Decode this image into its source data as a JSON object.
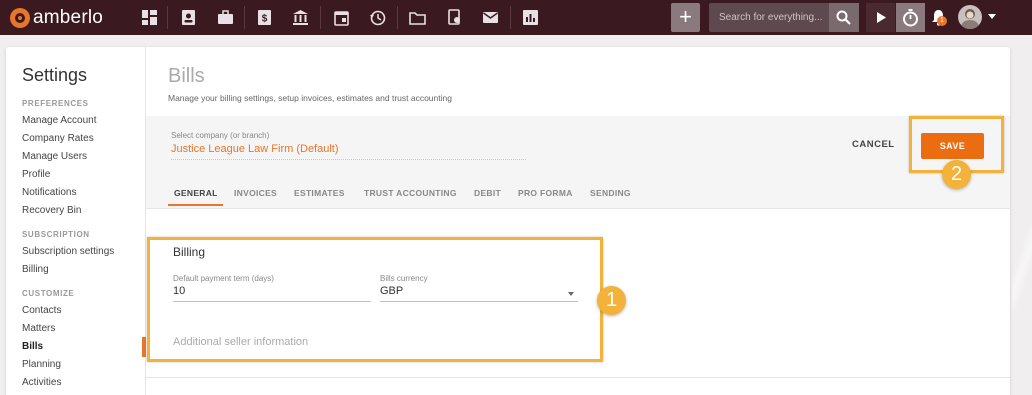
{
  "app": {
    "name": "amberlo"
  },
  "topbar": {
    "search_placeholder": "Search for everything...",
    "plus_label": "+",
    "notification_count": "1",
    "icons": [
      "dashboard-icon",
      "contacts-icon",
      "briefcase-icon",
      "invoice-icon",
      "bank-icon",
      "calendar-icon",
      "history-icon",
      "folder-icon",
      "documents-icon",
      "mail-icon",
      "reports-icon"
    ]
  },
  "sidebar": {
    "title": "Settings",
    "sections": [
      {
        "label": "PREFERENCES",
        "items": [
          "Manage Account",
          "Company Rates",
          "Manage Users",
          "Profile",
          "Notifications",
          "Recovery Bin"
        ]
      },
      {
        "label": "SUBSCRIPTION",
        "items": [
          "Subscription settings",
          "Billing"
        ]
      },
      {
        "label": "CUSTOMIZE",
        "items": [
          "Contacts",
          "Matters",
          "Bills",
          "Planning",
          "Activities"
        ]
      }
    ],
    "active_item": "Bills"
  },
  "page": {
    "title": "Bills",
    "description": "Manage your billing settings, setup invoices, estimates and trust accounting",
    "company_label": "Select company (or branch)",
    "company_value": "Justice League Law Firm (Default)",
    "cancel_label": "CANCEL",
    "save_label": "SAVE",
    "tabs": [
      "GENERAL",
      "INVOICES",
      "ESTIMATES",
      "TRUST ACCOUNTING",
      "DEBIT",
      "PRO FORMA",
      "SENDING"
    ],
    "active_tab": "GENERAL"
  },
  "billing": {
    "title": "Billing",
    "payment_term_label": "Default payment term (days)",
    "payment_term_value": "10",
    "currency_label": "Bills currency",
    "currency_value": "GBP",
    "additional_info_label": "Additional seller information"
  },
  "callouts": {
    "one": "1",
    "two": "2"
  },
  "colors": {
    "accent": "#ec6c12",
    "topbar": "#3a1a20",
    "highlight": "#f3b23a"
  }
}
